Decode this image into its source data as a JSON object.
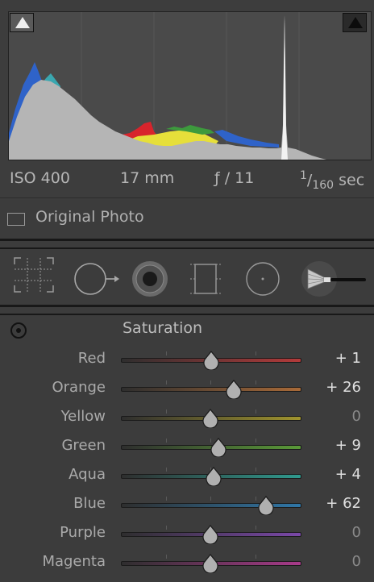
{
  "histogram": {
    "shadow_clip_icon": "triangle-up-icon",
    "highlight_clip_icon": "triangle-up-icon",
    "colors": {
      "blue": "#2f63c9",
      "red": "#d8242c",
      "yellow": "#e6df3a",
      "green": "#3d9a3d",
      "cyan": "#3aa7b0",
      "luminance": "#b5b5b5"
    }
  },
  "exif": {
    "iso": "ISO 400",
    "focal_length": "17 mm",
    "aperture": "ƒ / 11",
    "shutter_num": "1",
    "shutter_den": "160",
    "shutter_unit": "sec"
  },
  "original_photo": {
    "label": "Original Photo",
    "checked": false
  },
  "tools": [
    {
      "name": "crop-overlay",
      "icon": "crop-grid-icon"
    },
    {
      "name": "spot-removal",
      "icon": "spot-removal-icon"
    },
    {
      "name": "red-eye",
      "icon": "red-eye-icon"
    },
    {
      "name": "graduated-filter",
      "icon": "graduated-filter-icon"
    },
    {
      "name": "radial-filter",
      "icon": "radial-filter-icon"
    },
    {
      "name": "adjustment-brush",
      "icon": "brush-icon"
    }
  ],
  "hsl": {
    "target_icon": "target-adjust-icon",
    "title": "Saturation",
    "sliders": [
      {
        "label": "Red",
        "value": "+ 1",
        "num": 1,
        "color": "#b33a3a"
      },
      {
        "label": "Orange",
        "value": "+ 26",
        "num": 26,
        "color": "#a86a38"
      },
      {
        "label": "Yellow",
        "value": "0",
        "num": 0,
        "color": "#a0942e"
      },
      {
        "label": "Green",
        "value": "+ 9",
        "num": 9,
        "color": "#5a9a38"
      },
      {
        "label": "Aqua",
        "value": "+ 4",
        "num": 4,
        "color": "#2f9a8e"
      },
      {
        "label": "Blue",
        "value": "+ 62",
        "num": 62,
        "color": "#2f77a8"
      },
      {
        "label": "Purple",
        "value": "0",
        "num": 0,
        "color": "#7a48a8"
      },
      {
        "label": "Magenta",
        "value": "0",
        "num": 0,
        "color": "#a83a8a"
      }
    ]
  }
}
